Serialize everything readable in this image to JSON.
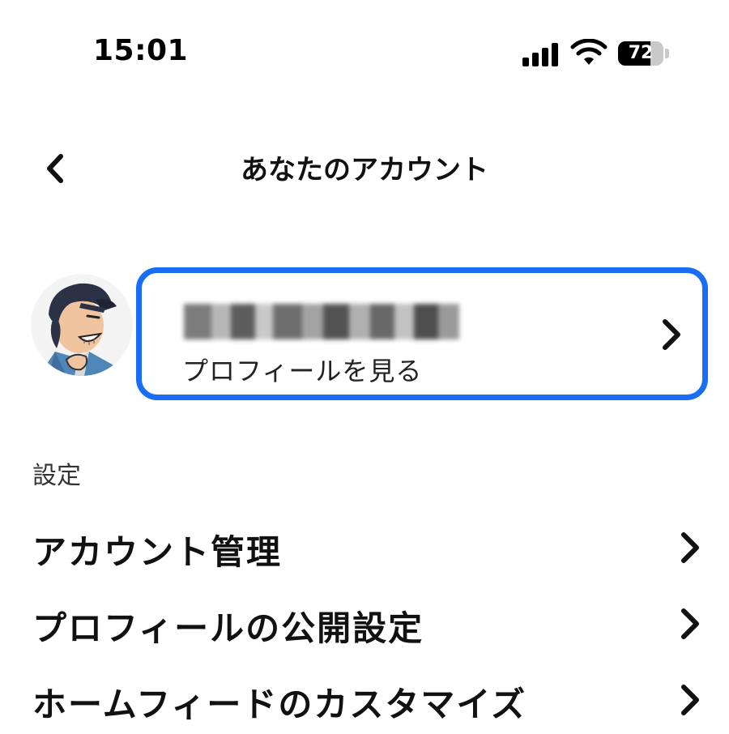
{
  "status_bar": {
    "time": "15:01",
    "battery_percent": "72",
    "battery_level": 0.72,
    "icons": [
      "cellular-signal-icon",
      "wifi-icon",
      "battery-icon"
    ]
  },
  "header": {
    "title": "あなたのアカウント",
    "back_icon": "chevron-left-icon"
  },
  "profile": {
    "view_profile_label": "プロフィールを見る",
    "highlight_color": "#1a6df5",
    "chevron_icon": "chevron-right-icon"
  },
  "settings": {
    "section_label": "設定",
    "items": [
      {
        "label": "アカウント管理"
      },
      {
        "label": "プロフィールの公開設定"
      },
      {
        "label": "ホームフィードのカスタマイズ"
      }
    ]
  }
}
